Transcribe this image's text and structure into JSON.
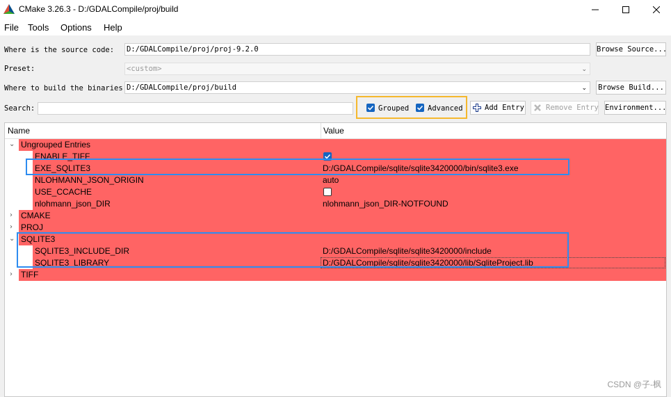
{
  "window": {
    "title": "CMake 3.26.3 - D:/GDALCompile/proj/build"
  },
  "menu": [
    "File",
    "Tools",
    "Options",
    "Help"
  ],
  "source": {
    "label": "Where is the source code:",
    "value": "D:/GDALCompile/proj/proj-9.2.0",
    "browse_label": "Browse Source..."
  },
  "preset": {
    "label": "Preset:",
    "value": "<custom>"
  },
  "build": {
    "label": "Where to build the binaries:",
    "value": "D:/GDALCompile/proj/build",
    "browse_label": "Browse Build..."
  },
  "search": {
    "label": "Search:",
    "value": ""
  },
  "options": {
    "grouped": {
      "label": "Grouped",
      "checked": true
    },
    "advanced": {
      "label": "Advanced",
      "checked": true
    },
    "add_entry_label": "Add Entry",
    "remove_entry_label": "Remove Entry",
    "environment_label": "Environment..."
  },
  "table": {
    "headers": {
      "name": "Name",
      "value": "Value"
    },
    "groups": [
      {
        "name": "Ungrouped Entries",
        "expanded": true,
        "entries": [
          {
            "name": "ENABLE_TIFF",
            "value": "",
            "checkbox": true
          },
          {
            "name": "EXE_SQLITE3",
            "value": "D:/GDALCompile/sqlite/sqlite3420000/bin/sqlite3.exe"
          },
          {
            "name": "NLOHMANN_JSON_ORIGIN",
            "value": "auto"
          },
          {
            "name": "USE_CCACHE",
            "value": "",
            "checkbox": false
          },
          {
            "name": "nlohmann_json_DIR",
            "value": "nlohmann_json_DIR-NOTFOUND"
          }
        ]
      },
      {
        "name": "CMAKE",
        "expanded": false
      },
      {
        "name": "PROJ",
        "expanded": false
      },
      {
        "name": "SQLITE3",
        "expanded": true,
        "entries": [
          {
            "name": "SQLITE3_INCLUDE_DIR",
            "value": "D:/GDALCompile/sqlite/sqlite3420000/include"
          },
          {
            "name": "SQLITE3_LIBRARY",
            "value": "D:/GDALCompile/sqlite/sqlite3420000/lib/SqliteProject.lib"
          }
        ]
      },
      {
        "name": "TIFF",
        "expanded": false
      }
    ]
  },
  "watermark": "CSDN @子-枫",
  "colors": {
    "new_entry_bg": "#ff6464",
    "checkbox_accent": "#1565c0",
    "highlight_blue": "#2d8cf0",
    "highlight_orange": "#f5b82e"
  }
}
